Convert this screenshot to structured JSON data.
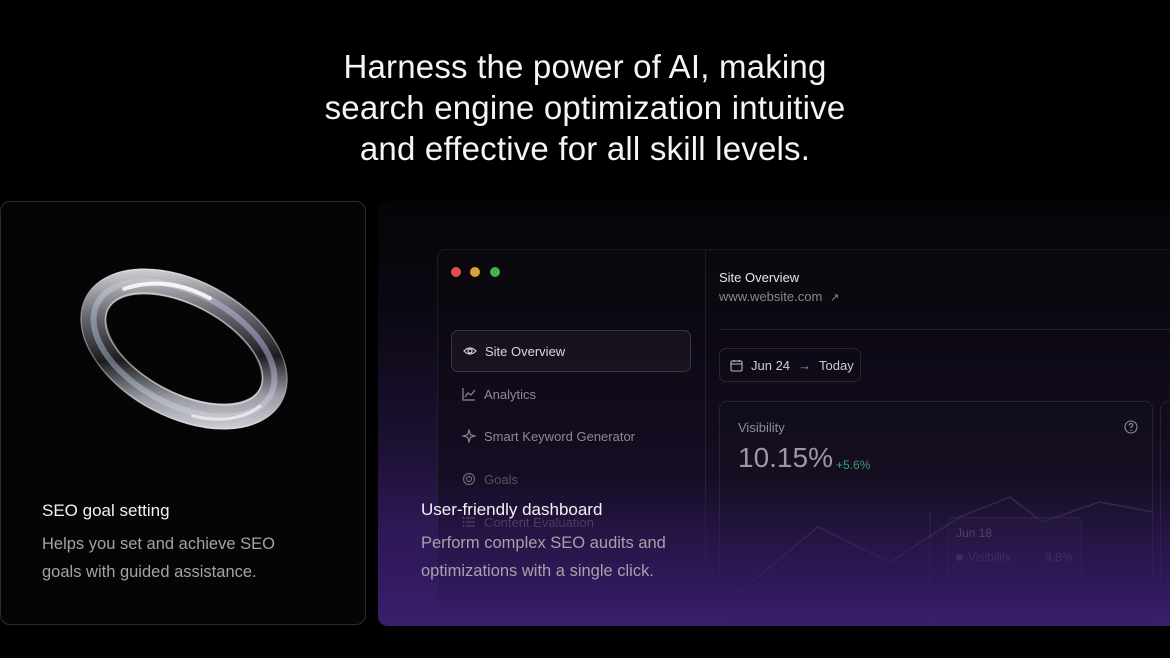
{
  "headline": {
    "line1": "Harness the power of AI, making",
    "line2": "search engine optimization intuitive",
    "line3": "and effective for all skill levels."
  },
  "left_card": {
    "title": "SEO goal setting",
    "desc_line1": "Helps you set and achieve SEO",
    "desc_line2": "goals with guided assistance."
  },
  "right_card": {
    "title": "User-friendly dashboard",
    "desc_line1": "Perform complex SEO audits and",
    "desc_line2": "optimizations with a single click."
  },
  "window_controls": {
    "colors": [
      "#e0504a",
      "#d9a23b",
      "#3fb34f"
    ]
  },
  "sidebar": {
    "items": [
      {
        "label": "Site Overview",
        "icon": "eye-icon",
        "active": true
      },
      {
        "label": "Analytics",
        "icon": "chart-line-icon",
        "active": false
      },
      {
        "label": "Smart Keyword Generator",
        "icon": "sparkle-icon",
        "active": false
      },
      {
        "label": "Goals",
        "icon": "target-icon",
        "active": false
      },
      {
        "label": "Content Evaluation",
        "icon": "list-icon",
        "active": false
      }
    ]
  },
  "main": {
    "title": "Site Overview",
    "url": "www.website.com",
    "date_from": "Jun 24",
    "date_to": "Today",
    "visibility": {
      "label": "Visibility",
      "value": "10.15%",
      "change": "+5.6%"
    },
    "tooltip": {
      "date": "Jun 18",
      "series": "Visibility",
      "value": "9.8%"
    }
  },
  "colors": {
    "accent_purple": "#3a1b6c",
    "positive_green": "#3e9c7c"
  }
}
